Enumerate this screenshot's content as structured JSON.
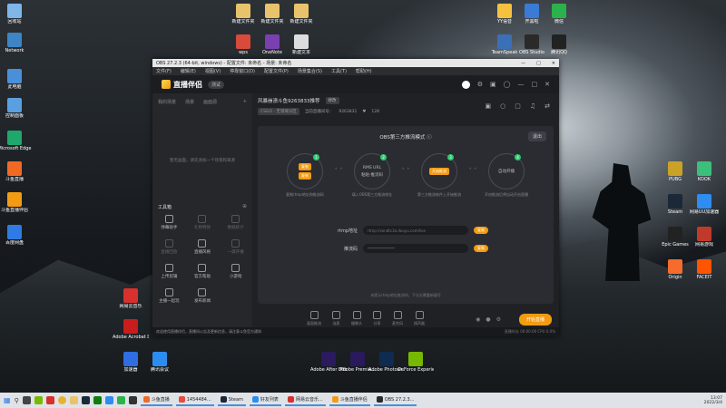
{
  "desktop": {
    "icons_left": [
      {
        "label": "回收站",
        "color": "#7eb6e8"
      },
      {
        "label": "Network",
        "color": "#3d85c6"
      },
      {
        "label": "此电脑",
        "color": "#4a90d9"
      },
      {
        "label": "控制面板",
        "color": "#5aa0e0"
      },
      {
        "label": "Microsoft Edge",
        "color": "#1ea86b"
      },
      {
        "label": "斗鱼直播",
        "color": "#f06a24"
      },
      {
        "label": "斗鱼直播伴侣",
        "color": "#f39c12"
      },
      {
        "label": "百度网盘",
        "color": "#2f7be3"
      }
    ],
    "icons_top": [
      {
        "label": "新建文件夹",
        "color": "#e8c36b"
      },
      {
        "label": "新建文件夹",
        "color": "#e8c36b"
      },
      {
        "label": "新建文件夹",
        "color": "#e8c36b"
      },
      {
        "label": "wps",
        "color": "#d84a3a"
      },
      {
        "label": "OneNote",
        "color": "#7a3fb0"
      },
      {
        "label": "新建文本",
        "color": "#dddddd"
      }
    ],
    "icons_right_top": [
      {
        "label": "YY语音",
        "color": "#f6c23d"
      },
      {
        "label": "开黑啦",
        "color": "#3a7bd5"
      },
      {
        "label": "微信",
        "color": "#2bb24c"
      },
      {
        "label": "TeamSpeak",
        "color": "#3b6fb6"
      },
      {
        "label": "OBS Studio",
        "color": "#2a2a2a"
      },
      {
        "label": "腾讯QQ",
        "color": "#222222"
      }
    ],
    "icons_right": [
      {
        "label": "PUBG",
        "color": "#c9a227"
      },
      {
        "label": "KOOK",
        "color": "#3cbf7a"
      },
      {
        "label": "Steam",
        "color": "#1b2838"
      },
      {
        "label": "网易UU加速器",
        "color": "#2f8cf0"
      },
      {
        "label": "Epic Games",
        "color": "#222222"
      },
      {
        "label": "网易游戏",
        "color": "#c0392b"
      },
      {
        "label": "Origin",
        "color": "#f56c2d"
      },
      {
        "label": "FACEIT",
        "color": "#ff5500"
      }
    ],
    "icons_bottom": [
      {
        "label": "网易云音乐",
        "color": "#d7312e"
      },
      {
        "label": "Adobe Acrobat DC",
        "color": "#c91c1c"
      },
      {
        "label": "加速器",
        "color": "#2e6ee0"
      },
      {
        "label": "腾讯会议",
        "color": "#2d8cf0"
      },
      {
        "label": "Adobe After Effects 2020",
        "color": "#2b1a5e"
      },
      {
        "label": "Adobe Premie...",
        "color": "#2a1a5c"
      },
      {
        "label": "Adobe Photosh...",
        "color": "#0f2b4f"
      },
      {
        "label": "GeForce Experience",
        "color": "#76b900"
      }
    ]
  },
  "obs": {
    "title": "OBS 27.2.3 (64-bit, windows) - 配置文件: 未命名 - 场景: 未命名",
    "menu": [
      "文件(F)",
      "编辑(E)",
      "视图(V)",
      "停靠窗口(D)",
      "配置文件(P)",
      "场景集合(S)",
      "工具(T)",
      "帮助(H)"
    ],
    "app_name": "直播伴侣",
    "version_pill": "测试",
    "left_tabs": [
      "我的场景",
      "场景",
      "画面源"
    ],
    "empty_text": "暂无画面，请先添加一个场景和来源",
    "tools_title": "工具箱",
    "tools": [
      {
        "label": "弹幕助手",
        "dim": false
      },
      {
        "label": "礼物特效",
        "dim": true
      },
      {
        "label": "数据统计",
        "dim": true
      },
      {
        "label": "直播回放",
        "dim": true
      },
      {
        "label": "直播风格",
        "dim": false
      },
      {
        "label": "一键开播",
        "dim": true
      },
      {
        "label": "上传剪辑",
        "dim": false
      },
      {
        "label": "官方帮助",
        "dim": false
      },
      {
        "label": "小游戏",
        "dim": false
      },
      {
        "label": "主播一起玩",
        "dim": false
      },
      {
        "label": "发布新闻",
        "dim": false
      }
    ],
    "room_title": "风暴崩溃斗鱼9263833推荐",
    "edit_label": "修改",
    "category": "CSGO · 无领域分区",
    "room_info": "当前直播间号：",
    "room_id": "9263831",
    "fans_count": "128",
    "panel_title": "OBS第三方推流模式",
    "exit_label": "退出",
    "steps": [
      {
        "num": "1",
        "buttons": [
          "复制",
          "复制"
        ],
        "text": "复制rtmp地址和推流码"
      },
      {
        "num": "2",
        "lines": [
          "RMS URL",
          "粘贴·推流码"
        ],
        "text": "填入OBS第三方推流地址"
      },
      {
        "num": "3",
        "buttons": [
          "开始推流"
        ],
        "text": "第三方推流软件上开始推流"
      },
      {
        "num": "4",
        "lines": [
          "自动开播"
        ],
        "text": "开启推流后将自动开启直播"
      }
    ],
    "rtmp_label": "rtmp地址",
    "rtmp_value": "rtmp://sendtc3a.douyu.com/live",
    "key_label": "推流码",
    "key_value": "***************",
    "copy_label": "复制",
    "note": "未提示rtmp地址推流时，下次无需重新填写",
    "bottom_tools": [
      "画面推流",
      "连麦",
      "摄像头",
      "分享",
      "麦克风",
      "扬声器"
    ],
    "start_label": "开始直播",
    "status_left": "欢迎使用直播伴侣，直播间公告及更新信息，请注意斗鱼官方通知",
    "status_right": "直播时长 00:00:00  CPU  0.0%"
  },
  "taskbar": {
    "apps": [
      {
        "label": "斗鱼直播",
        "color": "#f06a24"
      },
      {
        "label": "1454484...",
        "color": "#e84c3d"
      },
      {
        "label": "Steam",
        "color": "#1b2838"
      },
      {
        "label": "好友列表",
        "color": "#2f8cf0"
      },
      {
        "label": "网易云音乐...",
        "color": "#d7312e"
      },
      {
        "label": "斗鱼直播伴侣",
        "color": "#f39c12"
      },
      {
        "label": "OBS 27.2.3...",
        "color": "#2a2a2a"
      }
    ],
    "time": "13:07",
    "date": "2022/3/4"
  }
}
